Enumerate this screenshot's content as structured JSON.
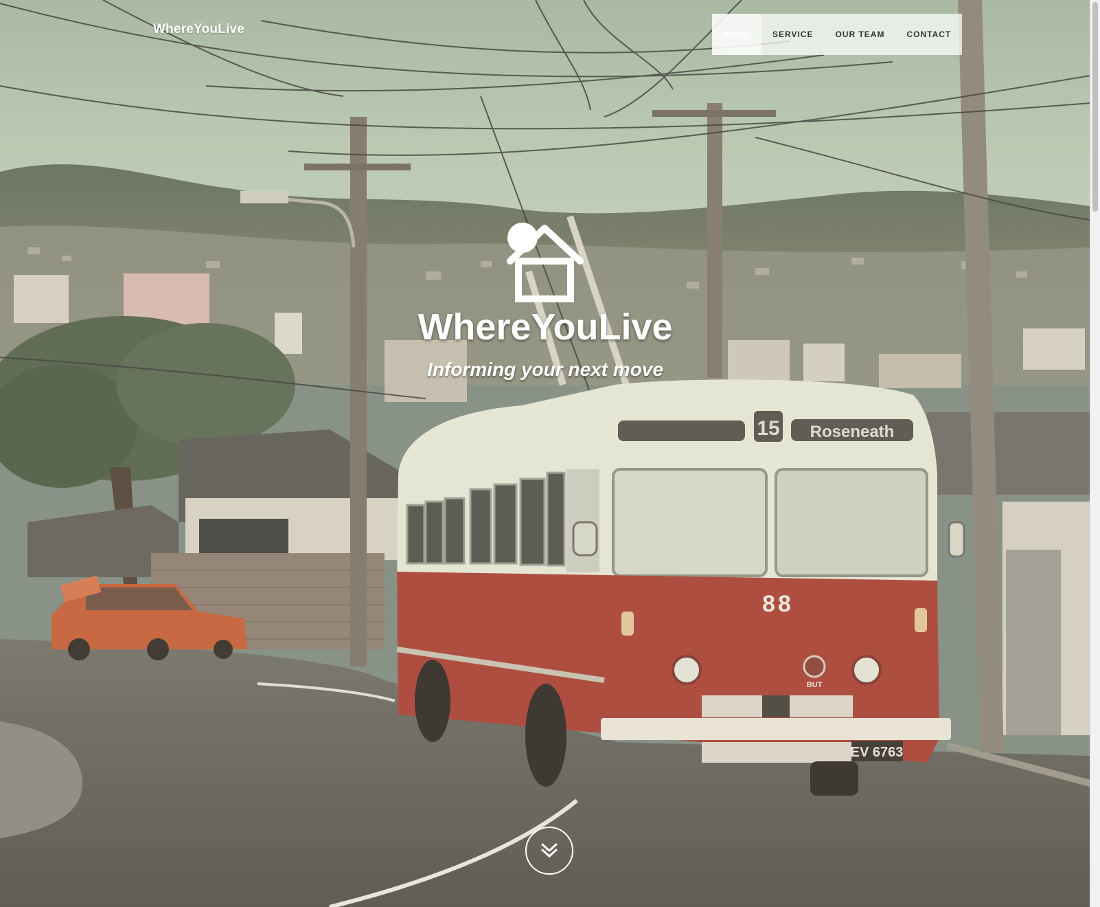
{
  "header": {
    "brand": "WhereYouLive"
  },
  "nav": {
    "items": [
      {
        "label": "HOME",
        "active": true
      },
      {
        "label": "SERVICE",
        "active": false
      },
      {
        "label": "OUR TEAM",
        "active": false
      },
      {
        "label": "CONTACT",
        "active": false
      }
    ]
  },
  "hero": {
    "logo_icon": "house-with-sun-icon",
    "title": "WhereYouLive",
    "subtitle": "Informing your next move",
    "scroll_icon": "double-chevron-down-icon",
    "background": {
      "image_text": {
        "route_number": "15",
        "destination": "Roseneath",
        "fleet_number": "88",
        "plate": "EV 6763",
        "badge": "BUT"
      }
    }
  }
}
